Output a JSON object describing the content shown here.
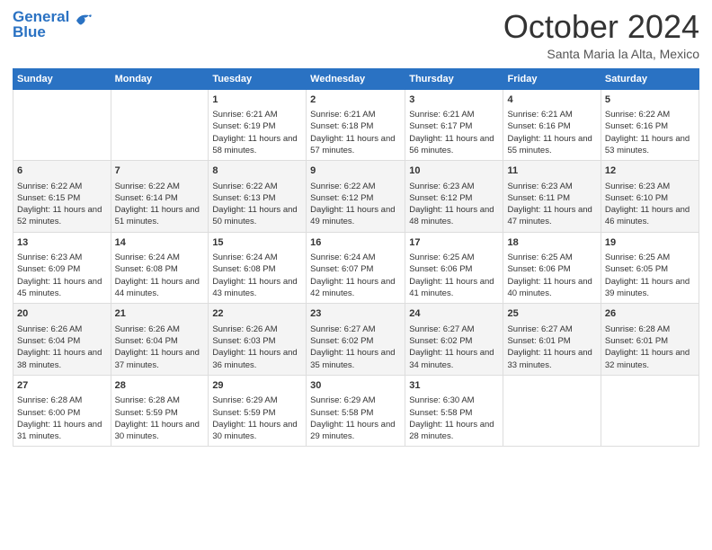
{
  "logo": {
    "line1": "General",
    "line2": "Blue"
  },
  "header": {
    "month": "October 2024",
    "location": "Santa Maria la Alta, Mexico"
  },
  "weekdays": [
    "Sunday",
    "Monday",
    "Tuesday",
    "Wednesday",
    "Thursday",
    "Friday",
    "Saturday"
  ],
  "weeks": [
    [
      {
        "day": "",
        "info": ""
      },
      {
        "day": "",
        "info": ""
      },
      {
        "day": "1",
        "info": "Sunrise: 6:21 AM\nSunset: 6:19 PM\nDaylight: 11 hours and 58 minutes."
      },
      {
        "day": "2",
        "info": "Sunrise: 6:21 AM\nSunset: 6:18 PM\nDaylight: 11 hours and 57 minutes."
      },
      {
        "day": "3",
        "info": "Sunrise: 6:21 AM\nSunset: 6:17 PM\nDaylight: 11 hours and 56 minutes."
      },
      {
        "day": "4",
        "info": "Sunrise: 6:21 AM\nSunset: 6:16 PM\nDaylight: 11 hours and 55 minutes."
      },
      {
        "day": "5",
        "info": "Sunrise: 6:22 AM\nSunset: 6:16 PM\nDaylight: 11 hours and 53 minutes."
      }
    ],
    [
      {
        "day": "6",
        "info": "Sunrise: 6:22 AM\nSunset: 6:15 PM\nDaylight: 11 hours and 52 minutes."
      },
      {
        "day": "7",
        "info": "Sunrise: 6:22 AM\nSunset: 6:14 PM\nDaylight: 11 hours and 51 minutes."
      },
      {
        "day": "8",
        "info": "Sunrise: 6:22 AM\nSunset: 6:13 PM\nDaylight: 11 hours and 50 minutes."
      },
      {
        "day": "9",
        "info": "Sunrise: 6:22 AM\nSunset: 6:12 PM\nDaylight: 11 hours and 49 minutes."
      },
      {
        "day": "10",
        "info": "Sunrise: 6:23 AM\nSunset: 6:12 PM\nDaylight: 11 hours and 48 minutes."
      },
      {
        "day": "11",
        "info": "Sunrise: 6:23 AM\nSunset: 6:11 PM\nDaylight: 11 hours and 47 minutes."
      },
      {
        "day": "12",
        "info": "Sunrise: 6:23 AM\nSunset: 6:10 PM\nDaylight: 11 hours and 46 minutes."
      }
    ],
    [
      {
        "day": "13",
        "info": "Sunrise: 6:23 AM\nSunset: 6:09 PM\nDaylight: 11 hours and 45 minutes."
      },
      {
        "day": "14",
        "info": "Sunrise: 6:24 AM\nSunset: 6:08 PM\nDaylight: 11 hours and 44 minutes."
      },
      {
        "day": "15",
        "info": "Sunrise: 6:24 AM\nSunset: 6:08 PM\nDaylight: 11 hours and 43 minutes."
      },
      {
        "day": "16",
        "info": "Sunrise: 6:24 AM\nSunset: 6:07 PM\nDaylight: 11 hours and 42 minutes."
      },
      {
        "day": "17",
        "info": "Sunrise: 6:25 AM\nSunset: 6:06 PM\nDaylight: 11 hours and 41 minutes."
      },
      {
        "day": "18",
        "info": "Sunrise: 6:25 AM\nSunset: 6:06 PM\nDaylight: 11 hours and 40 minutes."
      },
      {
        "day": "19",
        "info": "Sunrise: 6:25 AM\nSunset: 6:05 PM\nDaylight: 11 hours and 39 minutes."
      }
    ],
    [
      {
        "day": "20",
        "info": "Sunrise: 6:26 AM\nSunset: 6:04 PM\nDaylight: 11 hours and 38 minutes."
      },
      {
        "day": "21",
        "info": "Sunrise: 6:26 AM\nSunset: 6:04 PM\nDaylight: 11 hours and 37 minutes."
      },
      {
        "day": "22",
        "info": "Sunrise: 6:26 AM\nSunset: 6:03 PM\nDaylight: 11 hours and 36 minutes."
      },
      {
        "day": "23",
        "info": "Sunrise: 6:27 AM\nSunset: 6:02 PM\nDaylight: 11 hours and 35 minutes."
      },
      {
        "day": "24",
        "info": "Sunrise: 6:27 AM\nSunset: 6:02 PM\nDaylight: 11 hours and 34 minutes."
      },
      {
        "day": "25",
        "info": "Sunrise: 6:27 AM\nSunset: 6:01 PM\nDaylight: 11 hours and 33 minutes."
      },
      {
        "day": "26",
        "info": "Sunrise: 6:28 AM\nSunset: 6:01 PM\nDaylight: 11 hours and 32 minutes."
      }
    ],
    [
      {
        "day": "27",
        "info": "Sunrise: 6:28 AM\nSunset: 6:00 PM\nDaylight: 11 hours and 31 minutes."
      },
      {
        "day": "28",
        "info": "Sunrise: 6:28 AM\nSunset: 5:59 PM\nDaylight: 11 hours and 30 minutes."
      },
      {
        "day": "29",
        "info": "Sunrise: 6:29 AM\nSunset: 5:59 PM\nDaylight: 11 hours and 30 minutes."
      },
      {
        "day": "30",
        "info": "Sunrise: 6:29 AM\nSunset: 5:58 PM\nDaylight: 11 hours and 29 minutes."
      },
      {
        "day": "31",
        "info": "Sunrise: 6:30 AM\nSunset: 5:58 PM\nDaylight: 11 hours and 28 minutes."
      },
      {
        "day": "",
        "info": ""
      },
      {
        "day": "",
        "info": ""
      }
    ]
  ]
}
